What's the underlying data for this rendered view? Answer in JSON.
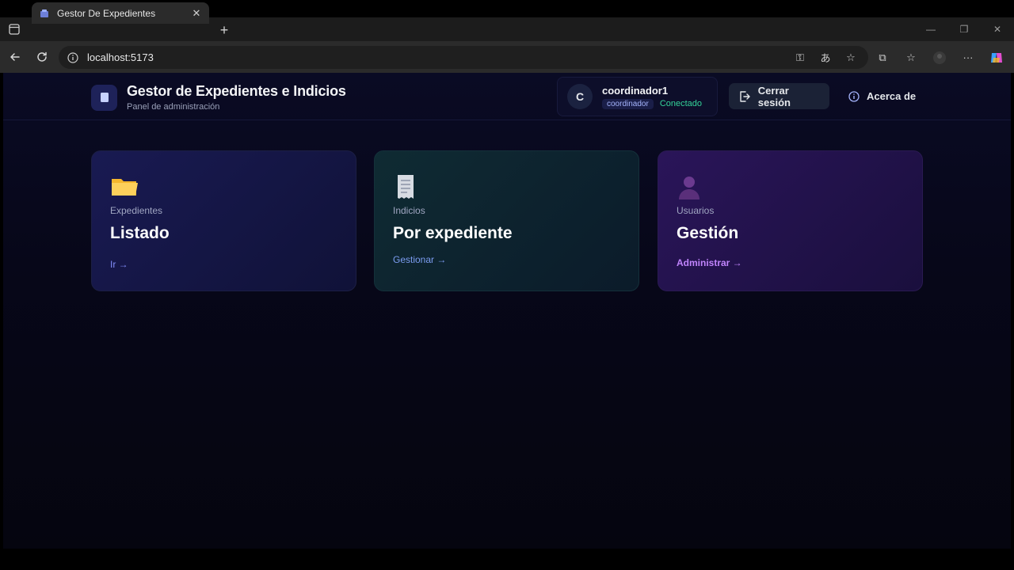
{
  "browser": {
    "tab_title": "Gestor De Expedientes",
    "url": "localhost:5173"
  },
  "app": {
    "title": "Gestor de Expedientes e Indicios",
    "subtitle": "Panel de administración",
    "user": {
      "initial": "C",
      "name": "coordinador1",
      "role": "coordinador",
      "status": "Conectado"
    },
    "logout_label": "Cerrar sesión",
    "about_label": "Acerca de"
  },
  "cards": [
    {
      "kicker": "Expedientes",
      "title": "Listado",
      "link": "Ir →",
      "icon": "folder-icon"
    },
    {
      "kicker": "Indicios",
      "title": "Por expediente",
      "link": "Gestionar →",
      "icon": "receipt-icon"
    },
    {
      "kicker": "Usuarios",
      "title": "Gestión",
      "link": "Administrar →",
      "icon": "user-icon"
    }
  ],
  "colors": {
    "background": "#070719",
    "accent_indigo": "#818cf8",
    "accent_purple": "#c084fc",
    "status_green": "#34d399"
  }
}
